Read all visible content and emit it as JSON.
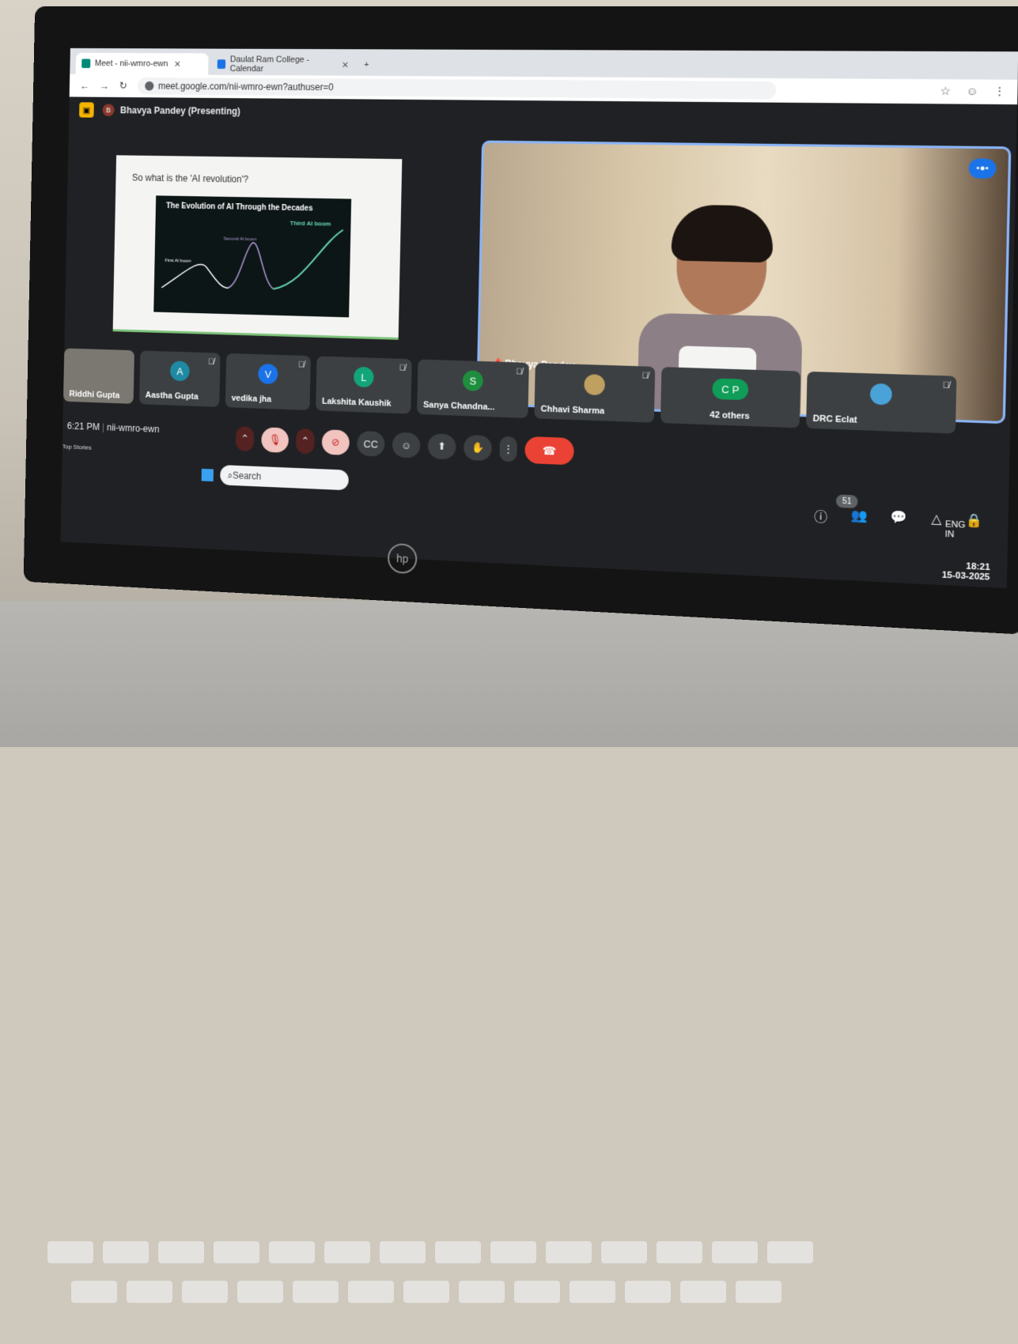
{
  "browser": {
    "tabs": [
      {
        "label": "Meet - nii-wmro-ewn",
        "active": true
      },
      {
        "label": "Daulat Ram College - Calendar",
        "active": false
      }
    ],
    "url": "meet.google.com/nii-wmro-ewn?authuser=0"
  },
  "meet": {
    "presenter_avatar": "B",
    "presenter_label": "Bhavya Pandey (Presenting)",
    "slide": {
      "question": "So what is the 'AI revolution'?",
      "chart_title": "The Evolution of AI Through the Decades",
      "labels": [
        "First AI boom",
        "Second AI boom",
        "Third AI boom"
      ]
    },
    "main_tile_name": "Bhavya Pandey",
    "participants": [
      {
        "name": "Riddhi Gupta",
        "initial": "",
        "color": "#6b6b6b"
      },
      {
        "name": "Aastha Gupta",
        "initial": "A",
        "color": "#1e8aa3"
      },
      {
        "name": "vedika jha",
        "initial": "V",
        "color": "#1a73e8"
      },
      {
        "name": "Lakshita Kaushik",
        "initial": "L",
        "color": "#12a57a"
      },
      {
        "name": "Sanya Chandna...",
        "initial": "S",
        "color": "#1e8e3e"
      },
      {
        "name": "Chhavi Sharma",
        "initial": "",
        "color": "#c0a060"
      },
      {
        "name": "42 others",
        "initial": "C P",
        "color": "#0f9d58"
      },
      {
        "name": "DRC Eclat",
        "initial": "",
        "color": "#4aa3d8"
      }
    ],
    "time": "6:21 PM",
    "meeting_code": "nii-wmro-ewn",
    "people_count": "51"
  },
  "taskbar": {
    "news_title": "Top Stories",
    "search": "Search",
    "lang": "ENG",
    "region": "IN",
    "clock_time": "18:21",
    "clock_date": "15-03-2025"
  }
}
